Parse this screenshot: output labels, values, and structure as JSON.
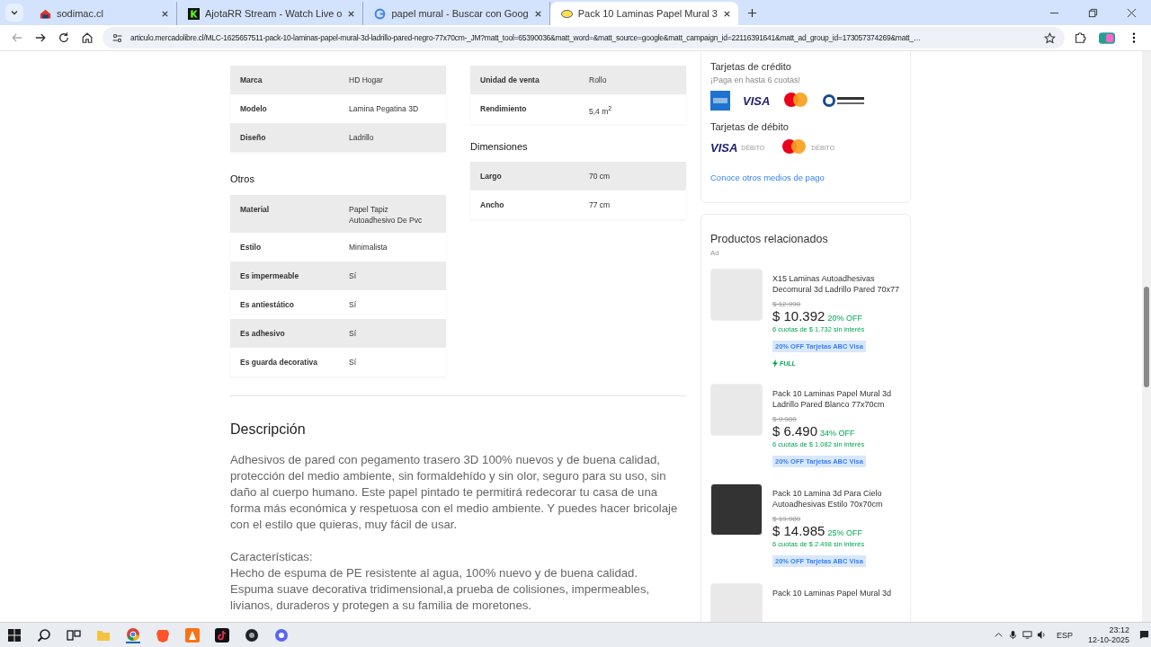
{
  "browser": {
    "tabs": [
      {
        "title": "sodimac.cl",
        "selected": false
      },
      {
        "title": "AjotaRR Stream - Watch Live o",
        "selected": false
      },
      {
        "title": "papel mural - Buscar con Goog",
        "selected": false
      },
      {
        "title": "Pack 10 Laminas Papel Mural 3",
        "selected": true
      }
    ],
    "url": "articulo.mercadolibre.cl/MLC-1625657511-pack-10-laminas-papel-mural-3d-ladrillo-pared-negro-77x70cm-_JM?matt_tool=65390036&matt_word=&matt_source=google&matt_campaign_id=22116391641&matt_ad_group_id=173057374269&matt_…"
  },
  "specs": {
    "left": [
      {
        "rows": [
          {
            "label": "Marca",
            "value": "HD Hogar"
          },
          {
            "label": "Modelo",
            "value": "Lamina Pegatina 3D"
          },
          {
            "label": "Diseño",
            "value": "Ladrillo"
          }
        ]
      },
      {
        "heading": "Otros",
        "rows": [
          {
            "label": "Material",
            "value": "Papel Tapiz Autoadhesivo De Pvc"
          },
          {
            "label": "Estilo",
            "value": "Minimalista"
          },
          {
            "label": "Es impermeable",
            "value": "Sí"
          },
          {
            "label": "Es antiestático",
            "value": "Sí"
          },
          {
            "label": "Es adhesivo",
            "value": "Sí"
          },
          {
            "label": "Es guarda decorativa",
            "value": "Sí"
          }
        ]
      }
    ],
    "right": [
      {
        "rows": [
          {
            "label": "Unidad de venta",
            "value": "Rollo"
          },
          {
            "label": "Rendimiento",
            "value": "5,4 m$^{2}$"
          }
        ]
      },
      {
        "heading": "Dimensiones",
        "rows": [
          {
            "label": "Largo",
            "value": "70 cm"
          },
          {
            "label": "Ancho",
            "value": "77 cm"
          }
        ]
      }
    ]
  },
  "description": {
    "heading": "Descripción",
    "paragraph": "Adhesivos de pared con pegamento trasero 3D 100% nuevos y de buena calidad, protección del medio ambiente, sin formaldehído y sin olor, seguro para su uso, sin daño al cuerpo humano. Este papel pintado te permitirá redecorar tu casa de una forma más económica y respetuosa con el medio ambiente. Y puedes hacer bricolaje con el estilo que quieras, muy fácil de usar.",
    "features_heading": "Características:",
    "features": [
      "Hecho de espuma de PE resistente al agua, 100% nuevo y de buena calidad.",
      "Espuma suave decorativa tridimensional,a prueba de colisiones, impermeables,",
      "livianos, duraderos y protegen a su familia de moretones."
    ]
  },
  "payments": {
    "credit_title": "Tarjetas de crédito",
    "credit_note": "¡Paga en hasta 6 cuotas!",
    "credit_cards": [
      {
        "kind": "amex"
      },
      {
        "kind": "visa",
        "text": "VISA"
      },
      {
        "kind": "mastercard"
      },
      {
        "kind": "diners"
      }
    ],
    "debit_title": "Tarjetas de débito",
    "debit_cards": [
      {
        "kind": "visa",
        "text": "VISA",
        "note": "DÉBITO"
      },
      {
        "kind": "mastercard",
        "note": "DÉBITO"
      }
    ],
    "link": "Conoce otros medios de pago"
  },
  "related": {
    "title": "Productos relacionados",
    "ad": "Ad",
    "products": [
      {
        "title": "X15 Laminas Autoadhesivas Decomural 3d Ladrillo Pared 70x77",
        "old_price": "$ 12.990",
        "price": "$ 10.392",
        "discount": "20% OFF",
        "installments": "6 cuotas de $ 1.732 sin interés",
        "promo": "20% OFF Tarjetas ABC Visa",
        "badge": "FULL"
      },
      {
        "title": "Pack 10 Laminas Papel Mural 3d Ladrillo Pared Blanco 77x70cm",
        "old_price": "$ 9.980",
        "price": "$ 6.490",
        "discount": "34% OFF",
        "installments": "6 cuotas de $ 1.082 sin interés",
        "promo": "20% OFF Tarjetas ABC Visa"
      },
      {
        "title": "Pack 10 Lamina 3d Para Cielo Autoadhesivas Estilo 70x70cm",
        "old_price": "$ 19.980",
        "price": "$ 14.985",
        "discount": "25% OFF",
        "installments": "6 cuotas de $ 2.498 sin interés",
        "promo": "20% OFF Tarjetas ABC Visa"
      },
      {
        "title": "Pack 10 Laminas Papel Mural 3d"
      }
    ]
  },
  "taskbar": {
    "language": "ESP",
    "time": "23:12",
    "date": "12-10-2025"
  }
}
